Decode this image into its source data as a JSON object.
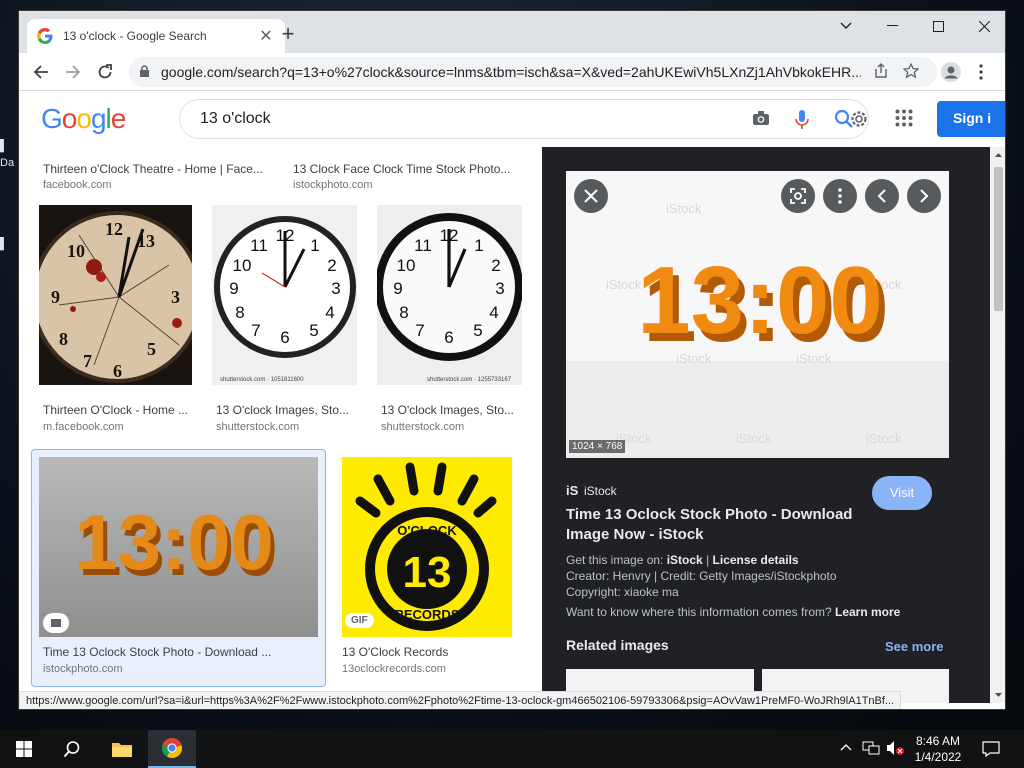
{
  "browser": {
    "tab_title": "13 o'clock - Google Search",
    "url": "google.com/search?q=13+o%27clock&source=lnms&tbm=isch&sa=X&ved=2ahUKEwiVh5LXnZj1AhVbkokEHR...",
    "status_url": "https://www.google.com/url?sa=i&url=https%3A%2F%2Fwww.istockphoto.com%2Fphoto%2Ftime-13-oclock-gm466502106-59793306&psig=AOvVaw1PreMF0-WoJRh9lA1TnBf..."
  },
  "google": {
    "logo": "Google",
    "query": "13 o'clock",
    "signin": "Sign i"
  },
  "results": {
    "top_row": [
      {
        "caption": "Thirteen o'Clock Theatre - Home | Face...",
        "source": "facebook.com"
      },
      {
        "caption": "13 Clock Face Clock Time Stock Photo...",
        "source": "istockphoto.com"
      }
    ],
    "row2": [
      {
        "caption": "Thirteen O'Clock - Home ...",
        "source": "m.facebook.com"
      },
      {
        "caption": "13 O'clock Images, Sto...",
        "source": "shutterstock.com",
        "watermark": "shutterstock.com · 1051811600"
      },
      {
        "caption": "13 O'clock Images, Sto...",
        "source": "shutterstock.com",
        "watermark": "shutterstock.com · 1255733167"
      }
    ],
    "row3": [
      {
        "caption": "Time 13 Oclock Stock Photo - Download ...",
        "source": "istockphoto.com"
      },
      {
        "caption": "13 O'Clock Records",
        "source": "13oclockrecords.com",
        "badge": "GIF"
      }
    ],
    "thumb_text": "13:00",
    "records_logo": {
      "top": "O'CLOCK",
      "num": "13",
      "bottom": "RECORDS"
    }
  },
  "panel": {
    "image_text": "13:00",
    "watermark": "iStock",
    "dimensions": "1024 × 768",
    "site_logo": "iS",
    "site": "iStock",
    "title_line1": "Time 13 Oclock Stock Photo - Download",
    "title_line2": "Image Now - iStock",
    "visit": "Visit",
    "get_image_prefix": "Get this image on: ",
    "get_image_site": "iStock",
    "separator": " | ",
    "license": "License details",
    "creator": "Creator: Henvry | Credit: Getty Images/iStockphoto",
    "copyright": "Copyright: xiaoke ma",
    "info_q": "Want to know where this information comes from? ",
    "learn_more": "Learn more",
    "related": "Related images",
    "see_more": "See more"
  },
  "desktop": {
    "sliver": "Da"
  },
  "taskbar": {
    "time": "8:46 AM",
    "date": "1/4/2022"
  },
  "colors": {
    "accent": "#1a73e8",
    "panel_bg": "#202124",
    "orange": "#f08a10"
  }
}
